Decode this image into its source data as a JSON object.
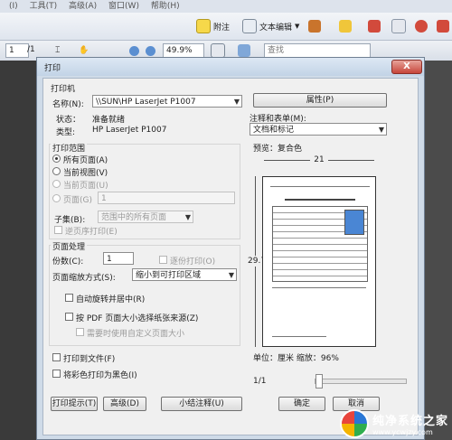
{
  "app": {
    "menu": [
      "(I)",
      "工具(T)",
      "高级(A)",
      "窗口(W)",
      "帮助(H)"
    ],
    "toolbar1": {
      "annotate_label": "附注",
      "text_edit_label": "文本编辑"
    },
    "toolbar2": {
      "page_current": "1",
      "page_total": "/1",
      "zoom": "49.9%",
      "search_placeholder": "查找"
    }
  },
  "dialog": {
    "title": "打印",
    "close": "X",
    "printer": {
      "group_label": "打印机",
      "name_label": "名称(N):",
      "name_value": "\\\\SUN\\HP LaserJet P1007",
      "status_label": "状态：",
      "status_value": "准备就绪",
      "type_label": "类型:",
      "type_value": "HP LaserJet P1007",
      "properties_button": "属性(P)",
      "comments_label": "注释和表单(M):",
      "comments_value": "文档和标记"
    },
    "range": {
      "group_label": "打印范围",
      "all_pages": "所有页面(A)",
      "current_view": "当前视图(V)",
      "current_page": "当前页面(U)",
      "pages": "页面(G)",
      "pages_value": "1",
      "subset_label": "子集(B):",
      "subset_value": "范围中的所有页面",
      "reverse": "逆页序打印(E)"
    },
    "handling": {
      "group_label": "页面处理",
      "copies_label": "份数(C):",
      "copies_value": "1",
      "collate": "逐份打印(O)",
      "scaling_label": "页面缩放方式(S):",
      "scaling_value": "缩小到可打印区域",
      "auto_rotate": "自动旋转并居中(R)",
      "choose_source": "按 PDF 页面大小选择纸张来源(Z)",
      "custom_size": "需要时使用自定义页面大小"
    },
    "print_to_file": "打印到文件(F)",
    "print_color_black": "将彩色打印为黑色(I)",
    "preview": {
      "label": "预览：复合色",
      "width": "21",
      "height": "29.7",
      "units_zoom": "单位：厘米 缩放：96%",
      "page_of": "1/1"
    },
    "buttons": {
      "tips": "打印提示(T)",
      "advanced": "高级(D)",
      "summarize": "小结注释(U)",
      "ok": "确定",
      "cancel": "取消"
    }
  },
  "watermark": {
    "title": "纯净系统之家",
    "url": "www.ycwjzy.com"
  },
  "colors": {
    "accent_blue": "#2a77d6",
    "dialog_frame": "#cfdbe8",
    "body_bg": "#f0f0f0"
  }
}
